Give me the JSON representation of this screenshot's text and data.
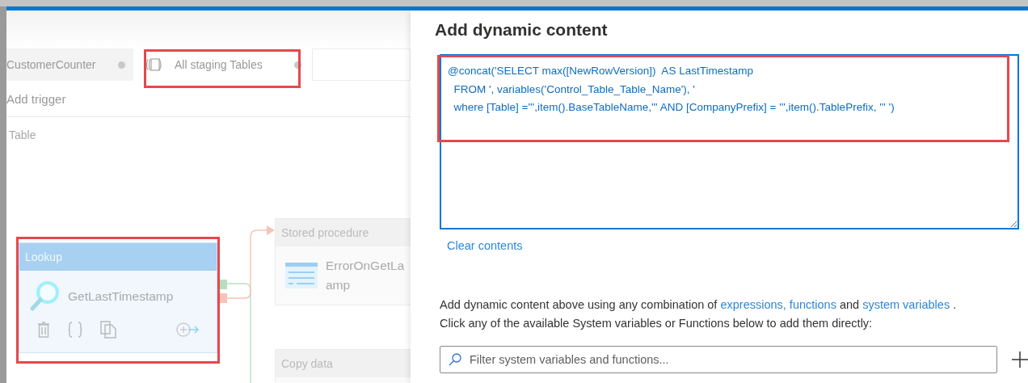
{
  "tabs": [
    {
      "label": "CustomerCounter",
      "selected": false
    },
    {
      "label": "All staging Tables",
      "selected": true
    }
  ],
  "toolbar": {
    "add_trigger": "Add trigger"
  },
  "breadcrumb": "Table",
  "activities": [
    {
      "kind": "lookup",
      "type": "Lookup",
      "name_lines": [
        "GetLastTimestamp"
      ],
      "selected": true
    },
    {
      "kind": "stored_procedure",
      "type": "Stored procedure",
      "name_lines": [
        "ErrorOnGetLa",
        "amp"
      ],
      "selected": false
    },
    {
      "kind": "copy",
      "type": "Copy data",
      "selected": false
    }
  ],
  "panel": {
    "title": "Add dynamic content",
    "expression": "@concat('SELECT max([NewRowVersion])  AS LastTimestamp\n  FROM ', variables('Control_Table_Table_Name'), '\n  where [Table] =''',item().BaseTableName,''' AND [CompanyPrefix] = ''',item().TablePrefix, ''' ')",
    "clear": "Clear contents",
    "help": {
      "before": "Add dynamic content above using any combination of",
      "link1": "expressions, functions",
      "middle": "and",
      "link2": "system variables",
      "after": "."
    },
    "help_line2": "Click any of the available System variables or Functions below to add them directly:",
    "filter": {
      "placeholder": "Filter system variables and functions..."
    }
  }
}
